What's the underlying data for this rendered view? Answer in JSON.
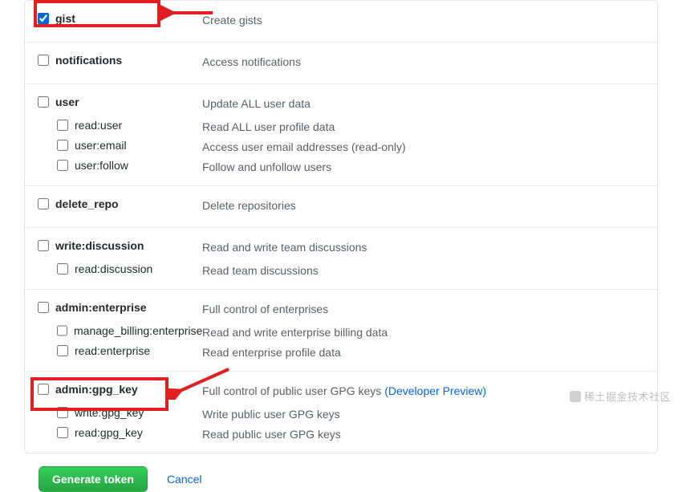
{
  "scopes": {
    "gist": {
      "label": "gist",
      "desc": "Create gists",
      "checked": true
    },
    "notifications": {
      "label": "notifications",
      "desc": "Access notifications",
      "checked": false
    },
    "user": {
      "label": "user",
      "desc": "Update ALL user data",
      "checked": false,
      "children": {
        "read_user": {
          "label": "read:user",
          "desc": "Read ALL user profile data",
          "checked": false
        },
        "user_email": {
          "label": "user:email",
          "desc": "Access user email addresses (read-only)",
          "checked": false
        },
        "user_follow": {
          "label": "user:follow",
          "desc": "Follow and unfollow users",
          "checked": false
        }
      }
    },
    "delete_repo": {
      "label": "delete_repo",
      "desc": "Delete repositories",
      "checked": false
    },
    "write_discussion": {
      "label": "write:discussion",
      "desc": "Read and write team discussions",
      "checked": false,
      "children": {
        "read_discussion": {
          "label": "read:discussion",
          "desc": "Read team discussions",
          "checked": false
        }
      }
    },
    "admin_enterprise": {
      "label": "admin:enterprise",
      "desc": "Full control of enterprises",
      "checked": false,
      "children": {
        "manage_billing_enterprise": {
          "label": "manage_billing:enterprise",
          "desc": "Read and write enterprise billing data",
          "checked": false
        },
        "read_enterprise": {
          "label": "read:enterprise",
          "desc": "Read enterprise profile data",
          "checked": false
        }
      }
    },
    "admin_gpg_key": {
      "label": "admin:gpg_key",
      "desc_pre": "Full control of public user GPG keys ",
      "desc_link": "(Developer Preview)",
      "checked": false,
      "children": {
        "write_gpg_key": {
          "label": "write:gpg_key",
          "desc": "Write public user GPG keys",
          "checked": false
        },
        "read_gpg_key": {
          "label": "read:gpg_key",
          "desc": "Read public user GPG keys",
          "checked": false
        }
      }
    }
  },
  "actions": {
    "generate": "Generate token",
    "cancel": "Cancel"
  },
  "watermark": "稀土掘金技术社区"
}
